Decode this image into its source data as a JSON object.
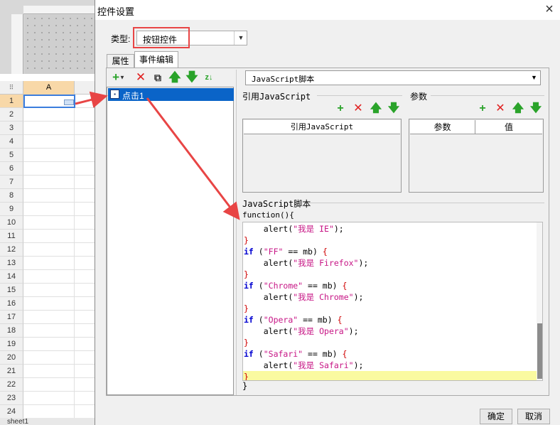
{
  "spreadsheet": {
    "column_header": "A",
    "rows": [
      "1",
      "2",
      "3",
      "4",
      "5",
      "6",
      "7",
      "8",
      "9",
      "10",
      "11",
      "12",
      "13",
      "14",
      "15",
      "16",
      "17",
      "18",
      "19",
      "20",
      "21",
      "22",
      "23",
      "24"
    ],
    "sheet_tab": "sheet1"
  },
  "dialog": {
    "title": "控件设置",
    "close_icon": "×",
    "type_label": "类型:",
    "type_value": "按钮控件",
    "tabs": [
      "属性",
      "事件编辑"
    ],
    "event_list": [
      "点击1"
    ],
    "script_type": "JavaScript脚本",
    "ref_group_title": "引用JavaScript",
    "ref_column": "引用JavaScript",
    "param_group_title": "参数",
    "param_columns": [
      "参数",
      "值"
    ],
    "script_group_title": "JavaScript脚本",
    "function_header": "function(){",
    "function_footer": "}",
    "ok_label": "确定",
    "cancel_label": "取消",
    "toolbar_icons": [
      "add-dropdown-icon",
      "delete-icon",
      "copy-icon",
      "move-up-icon",
      "move-down-icon",
      "sort-icon"
    ],
    "colors": {
      "accent": "#0a64c8",
      "add": "#2aa32a",
      "delete": "#e02020",
      "arrow": "#e84545"
    }
  },
  "code_lines": [
    {
      "indent": "    ",
      "parts": [
        {
          "t": "alert(",
          "c": ""
        },
        {
          "t": "\"我是 IE\"",
          "c": "str"
        },
        {
          "t": ");",
          "c": ""
        }
      ]
    },
    {
      "indent": "",
      "parts": [
        {
          "t": "}",
          "c": "brace"
        }
      ]
    },
    {
      "indent": "",
      "parts": [
        {
          "t": "if",
          "c": "kw"
        },
        {
          "t": " (",
          "c": ""
        },
        {
          "t": "\"FF\"",
          "c": "str"
        },
        {
          "t": " == mb) ",
          "c": ""
        },
        {
          "t": "{",
          "c": "brace"
        }
      ]
    },
    {
      "indent": "    ",
      "parts": [
        {
          "t": "alert(",
          "c": ""
        },
        {
          "t": "\"我是 Firefox\"",
          "c": "str"
        },
        {
          "t": ");",
          "c": ""
        }
      ]
    },
    {
      "indent": "",
      "parts": [
        {
          "t": "}",
          "c": "brace"
        }
      ]
    },
    {
      "indent": "",
      "parts": [
        {
          "t": "if",
          "c": "kw"
        },
        {
          "t": " (",
          "c": ""
        },
        {
          "t": "\"Chrome\"",
          "c": "str"
        },
        {
          "t": " == mb) ",
          "c": ""
        },
        {
          "t": "{",
          "c": "brace"
        }
      ]
    },
    {
      "indent": "    ",
      "parts": [
        {
          "t": "alert(",
          "c": ""
        },
        {
          "t": "\"我是 Chrome\"",
          "c": "str"
        },
        {
          "t": ");",
          "c": ""
        }
      ]
    },
    {
      "indent": "",
      "parts": [
        {
          "t": "}",
          "c": "brace"
        }
      ]
    },
    {
      "indent": "",
      "parts": [
        {
          "t": "if",
          "c": "kw"
        },
        {
          "t": " (",
          "c": ""
        },
        {
          "t": "\"Opera\"",
          "c": "str"
        },
        {
          "t": " == mb) ",
          "c": ""
        },
        {
          "t": "{",
          "c": "brace"
        }
      ]
    },
    {
      "indent": "    ",
      "parts": [
        {
          "t": "alert(",
          "c": ""
        },
        {
          "t": "\"我是 Opera\"",
          "c": "str"
        },
        {
          "t": ");",
          "c": ""
        }
      ]
    },
    {
      "indent": "",
      "parts": [
        {
          "t": "}",
          "c": "brace"
        }
      ]
    },
    {
      "indent": "",
      "parts": [
        {
          "t": "if",
          "c": "kw"
        },
        {
          "t": " (",
          "c": ""
        },
        {
          "t": "\"Safari\"",
          "c": "str"
        },
        {
          "t": " == mb) ",
          "c": ""
        },
        {
          "t": "{",
          "c": "brace"
        }
      ]
    },
    {
      "indent": "    ",
      "parts": [
        {
          "t": "alert(",
          "c": ""
        },
        {
          "t": "\"我是 Safari\"",
          "c": "str"
        },
        {
          "t": ");",
          "c": ""
        }
      ]
    },
    {
      "indent": "",
      "parts": [
        {
          "t": "}",
          "c": "brace"
        }
      ],
      "current": true
    }
  ]
}
